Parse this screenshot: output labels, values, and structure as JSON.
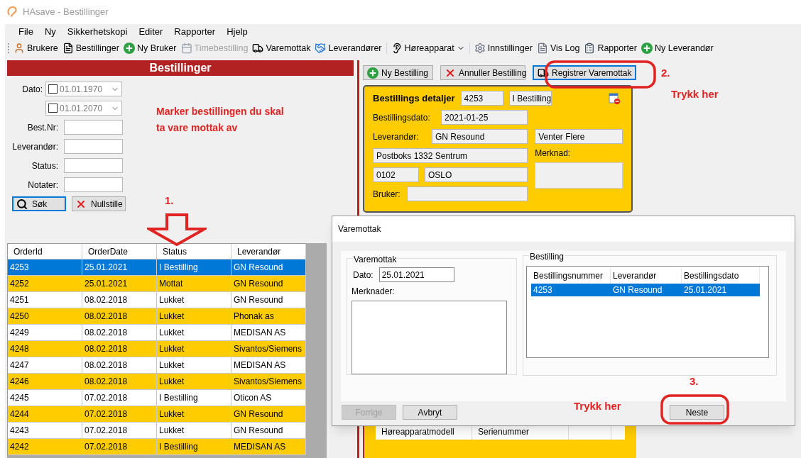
{
  "window": {
    "title": "HAsave - Bestillinger"
  },
  "menu": [
    "File",
    "Ny",
    "Sikkerhetskopi",
    "Editer",
    "Rapporter",
    "Hjelp"
  ],
  "toolbar": [
    {
      "items": [
        {
          "label": "Brukere",
          "kind": "person",
          "disabled": false,
          "dropdown": false
        },
        {
          "label": "Bestillinger",
          "kind": "document",
          "disabled": false,
          "dropdown": false
        },
        {
          "label": "Ny Bruker",
          "kind": "add",
          "disabled": false,
          "dropdown": false
        },
        {
          "label": "Timebestilling",
          "kind": "calendar",
          "disabled": true,
          "dropdown": false
        },
        {
          "label": "Varemottak",
          "kind": "truck",
          "disabled": false,
          "dropdown": false
        },
        {
          "label": "Leverandører",
          "kind": "handshake",
          "disabled": false,
          "dropdown": false
        }
      ]
    },
    {
      "items": [
        {
          "label": "Høreapparat",
          "kind": "ear",
          "disabled": false,
          "dropdown": true
        }
      ]
    },
    {
      "items": [
        {
          "label": "Innstillinger",
          "kind": "gear",
          "disabled": false,
          "dropdown": false
        },
        {
          "label": "Vis Log",
          "kind": "log",
          "disabled": false,
          "dropdown": false
        },
        {
          "label": "Rapporter",
          "kind": "clipboard",
          "disabled": false,
          "dropdown": false
        },
        {
          "label": "Ny Leverandør",
          "kind": "add",
          "disabled": false,
          "dropdown": false
        }
      ]
    }
  ],
  "filter": {
    "title": "Bestillinger",
    "dates": [
      {
        "label": "Dato:",
        "value": "01.01.1970",
        "checked": false
      },
      {
        "value": "01.01.2070",
        "checked": false
      }
    ],
    "fields": [
      {
        "label": "Best.Nr:"
      },
      {
        "label": "Leverandør:"
      },
      {
        "label": "Status:"
      },
      {
        "label": "Notater:"
      }
    ],
    "buttons": [
      {
        "label": "Søk",
        "kind": "search",
        "focused": true
      },
      {
        "label": "Nullstille",
        "kind": "clear",
        "focused": false
      }
    ]
  },
  "orders": {
    "columns": [
      "OrderId",
      "OrderDate",
      "Status",
      "Leverandør"
    ],
    "rows": [
      {
        "cells": [
          "4253",
          "25.01.2021",
          "I Bestilling",
          "GN Resound"
        ],
        "selected": true,
        "highlighted": false
      },
      {
        "cells": [
          "4252",
          "25.01.2021",
          "Mottat",
          "GN Resound"
        ],
        "selected": false,
        "highlighted": true
      },
      {
        "cells": [
          "4251",
          "08.02.2018",
          "Lukket",
          "GN Resound"
        ],
        "selected": false,
        "highlighted": false
      },
      {
        "cells": [
          "4250",
          "08.02.2018",
          "Lukket",
          "Phonak as"
        ],
        "selected": false,
        "highlighted": true
      },
      {
        "cells": [
          "4249",
          "08.02.2018",
          "Lukket",
          "MEDISAN AS"
        ],
        "selected": false,
        "highlighted": false
      },
      {
        "cells": [
          "4248",
          "08.02.2018",
          "Lukket",
          "Sivantos/Siemens"
        ],
        "selected": false,
        "highlighted": true
      },
      {
        "cells": [
          "4247",
          "08.02.2018",
          "Lukket",
          "MEDISAN AS"
        ],
        "selected": false,
        "highlighted": false
      },
      {
        "cells": [
          "4246",
          "08.02.2018",
          "Lukket",
          "Sivantos/Siemens"
        ],
        "selected": false,
        "highlighted": true
      },
      {
        "cells": [
          "4245",
          "07.02.2018",
          "I Bestilling",
          "Oticon AS"
        ],
        "selected": false,
        "highlighted": false
      },
      {
        "cells": [
          "4244",
          "07.02.2018",
          "Lukket",
          "GN Resound"
        ],
        "selected": false,
        "highlighted": true
      },
      {
        "cells": [
          "4243",
          "07.02.2018",
          "Lukket",
          "GN Resound"
        ],
        "selected": false,
        "highlighted": false
      },
      {
        "cells": [
          "4242",
          "07.02.2018",
          "I Bestilling",
          "MEDISAN AS"
        ],
        "selected": false,
        "highlighted": true
      }
    ]
  },
  "actions": [
    {
      "label": "Ny Bestilling",
      "kind": "add",
      "focused": false
    },
    {
      "label": "Annuller Bestilling",
      "kind": "cancel",
      "focused": false
    },
    {
      "label": "Registrer Varemottak",
      "kind": "truck",
      "focused": true
    }
  ],
  "details": {
    "title": "Bestillings detaljer",
    "number": "4253",
    "status": "I Bestilling",
    "date_label": "Bestillingsdato:",
    "date": "2021-01-25",
    "supplier_label": "Leverandør:",
    "supplier": "GN Resound",
    "address": "Postboks 1332 Sentrum",
    "zip": "0102",
    "city": "OSLO",
    "user_label": "Bruker:",
    "delivery": "Venter Flere",
    "note_label": "Merknad:"
  },
  "items_table": {
    "columns": [
      "Høreapparatmodell",
      "Serienummer"
    ]
  },
  "dialog": {
    "title": "Varemottak",
    "receipt_group": "Varemottak",
    "date_label": "Dato:",
    "date": "25.01.2021",
    "notes_label": "Merknader:",
    "order_group": "Bestilling",
    "columns": [
      "Bestillingsnummer",
      "Leverandør",
      "Bestillingsdato"
    ],
    "rows": [
      {
        "cells": [
          "4253",
          "GN Resound",
          "25.01.2021"
        ],
        "selected": true
      }
    ],
    "buttons": [
      {
        "label": "Forrige",
        "disabled": true
      },
      {
        "label": "Avbryt",
        "disabled": false
      },
      {
        "label": "Neste",
        "disabled": false
      }
    ]
  },
  "annotations": {
    "note": "Marker bestillingen du skal ta vare mottak av",
    "step_1": "1.",
    "step_2": "2.",
    "hint_2": "Trykk her",
    "step_3": "3.",
    "hint_3": "Trykk her"
  }
}
